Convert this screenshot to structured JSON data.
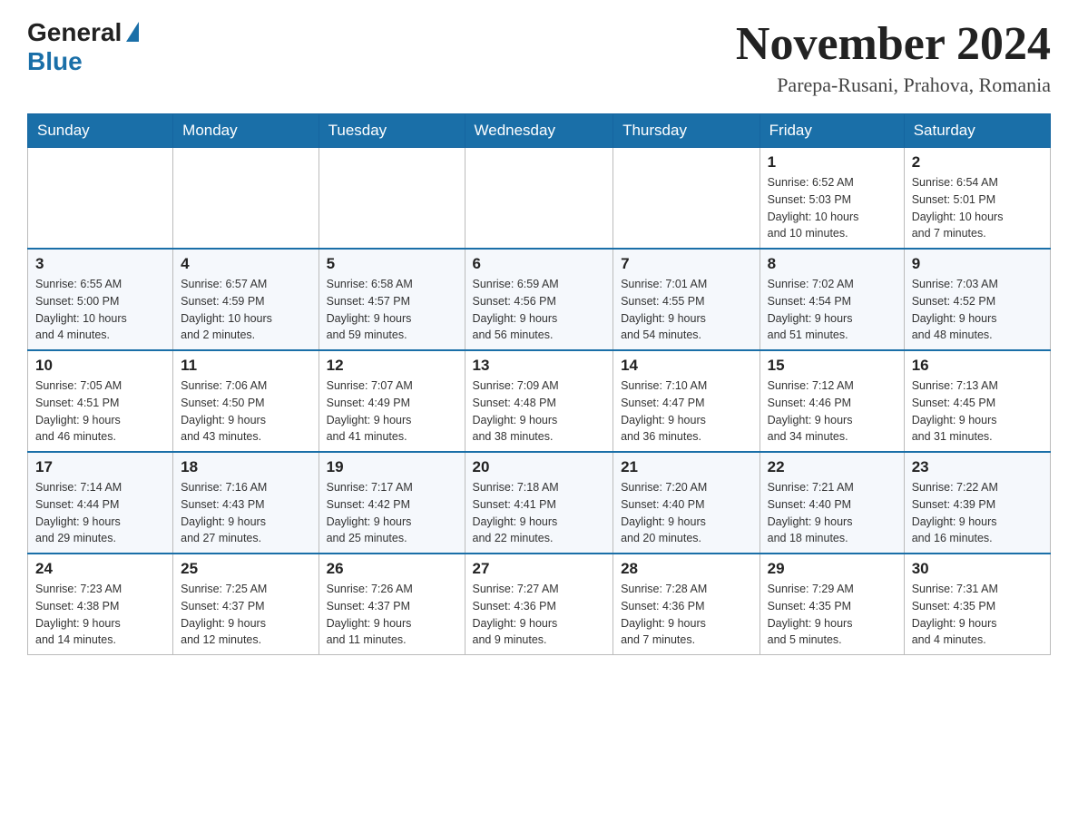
{
  "header": {
    "logo": {
      "general": "General",
      "blue": "Blue"
    },
    "title": "November 2024",
    "location": "Parepa-Rusani, Prahova, Romania"
  },
  "days_of_week": [
    "Sunday",
    "Monday",
    "Tuesday",
    "Wednesday",
    "Thursday",
    "Friday",
    "Saturday"
  ],
  "weeks": [
    {
      "days": [
        {
          "number": "",
          "info": ""
        },
        {
          "number": "",
          "info": ""
        },
        {
          "number": "",
          "info": ""
        },
        {
          "number": "",
          "info": ""
        },
        {
          "number": "",
          "info": ""
        },
        {
          "number": "1",
          "info": "Sunrise: 6:52 AM\nSunset: 5:03 PM\nDaylight: 10 hours\nand 10 minutes."
        },
        {
          "number": "2",
          "info": "Sunrise: 6:54 AM\nSunset: 5:01 PM\nDaylight: 10 hours\nand 7 minutes."
        }
      ]
    },
    {
      "days": [
        {
          "number": "3",
          "info": "Sunrise: 6:55 AM\nSunset: 5:00 PM\nDaylight: 10 hours\nand 4 minutes."
        },
        {
          "number": "4",
          "info": "Sunrise: 6:57 AM\nSunset: 4:59 PM\nDaylight: 10 hours\nand 2 minutes."
        },
        {
          "number": "5",
          "info": "Sunrise: 6:58 AM\nSunset: 4:57 PM\nDaylight: 9 hours\nand 59 minutes."
        },
        {
          "number": "6",
          "info": "Sunrise: 6:59 AM\nSunset: 4:56 PM\nDaylight: 9 hours\nand 56 minutes."
        },
        {
          "number": "7",
          "info": "Sunrise: 7:01 AM\nSunset: 4:55 PM\nDaylight: 9 hours\nand 54 minutes."
        },
        {
          "number": "8",
          "info": "Sunrise: 7:02 AM\nSunset: 4:54 PM\nDaylight: 9 hours\nand 51 minutes."
        },
        {
          "number": "9",
          "info": "Sunrise: 7:03 AM\nSunset: 4:52 PM\nDaylight: 9 hours\nand 48 minutes."
        }
      ]
    },
    {
      "days": [
        {
          "number": "10",
          "info": "Sunrise: 7:05 AM\nSunset: 4:51 PM\nDaylight: 9 hours\nand 46 minutes."
        },
        {
          "number": "11",
          "info": "Sunrise: 7:06 AM\nSunset: 4:50 PM\nDaylight: 9 hours\nand 43 minutes."
        },
        {
          "number": "12",
          "info": "Sunrise: 7:07 AM\nSunset: 4:49 PM\nDaylight: 9 hours\nand 41 minutes."
        },
        {
          "number": "13",
          "info": "Sunrise: 7:09 AM\nSunset: 4:48 PM\nDaylight: 9 hours\nand 38 minutes."
        },
        {
          "number": "14",
          "info": "Sunrise: 7:10 AM\nSunset: 4:47 PM\nDaylight: 9 hours\nand 36 minutes."
        },
        {
          "number": "15",
          "info": "Sunrise: 7:12 AM\nSunset: 4:46 PM\nDaylight: 9 hours\nand 34 minutes."
        },
        {
          "number": "16",
          "info": "Sunrise: 7:13 AM\nSunset: 4:45 PM\nDaylight: 9 hours\nand 31 minutes."
        }
      ]
    },
    {
      "days": [
        {
          "number": "17",
          "info": "Sunrise: 7:14 AM\nSunset: 4:44 PM\nDaylight: 9 hours\nand 29 minutes."
        },
        {
          "number": "18",
          "info": "Sunrise: 7:16 AM\nSunset: 4:43 PM\nDaylight: 9 hours\nand 27 minutes."
        },
        {
          "number": "19",
          "info": "Sunrise: 7:17 AM\nSunset: 4:42 PM\nDaylight: 9 hours\nand 25 minutes."
        },
        {
          "number": "20",
          "info": "Sunrise: 7:18 AM\nSunset: 4:41 PM\nDaylight: 9 hours\nand 22 minutes."
        },
        {
          "number": "21",
          "info": "Sunrise: 7:20 AM\nSunset: 4:40 PM\nDaylight: 9 hours\nand 20 minutes."
        },
        {
          "number": "22",
          "info": "Sunrise: 7:21 AM\nSunset: 4:40 PM\nDaylight: 9 hours\nand 18 minutes."
        },
        {
          "number": "23",
          "info": "Sunrise: 7:22 AM\nSunset: 4:39 PM\nDaylight: 9 hours\nand 16 minutes."
        }
      ]
    },
    {
      "days": [
        {
          "number": "24",
          "info": "Sunrise: 7:23 AM\nSunset: 4:38 PM\nDaylight: 9 hours\nand 14 minutes."
        },
        {
          "number": "25",
          "info": "Sunrise: 7:25 AM\nSunset: 4:37 PM\nDaylight: 9 hours\nand 12 minutes."
        },
        {
          "number": "26",
          "info": "Sunrise: 7:26 AM\nSunset: 4:37 PM\nDaylight: 9 hours\nand 11 minutes."
        },
        {
          "number": "27",
          "info": "Sunrise: 7:27 AM\nSunset: 4:36 PM\nDaylight: 9 hours\nand 9 minutes."
        },
        {
          "number": "28",
          "info": "Sunrise: 7:28 AM\nSunset: 4:36 PM\nDaylight: 9 hours\nand 7 minutes."
        },
        {
          "number": "29",
          "info": "Sunrise: 7:29 AM\nSunset: 4:35 PM\nDaylight: 9 hours\nand 5 minutes."
        },
        {
          "number": "30",
          "info": "Sunrise: 7:31 AM\nSunset: 4:35 PM\nDaylight: 9 hours\nand 4 minutes."
        }
      ]
    }
  ]
}
